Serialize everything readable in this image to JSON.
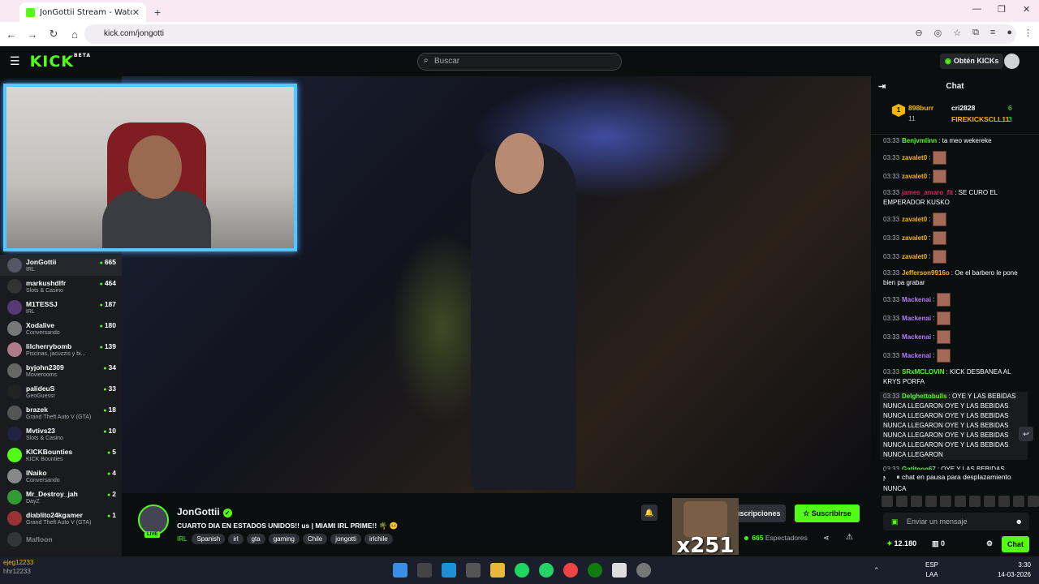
{
  "browser": {
    "tab_title": "JonGottii Stream - Watch Li",
    "url": "kick.com/jongotti"
  },
  "header": {
    "search_placeholder": "Buscar",
    "get_kicks": "Obtén KICKs"
  },
  "sidebar": {
    "items": [
      {
        "name": "JonGottii",
        "category": "IRL",
        "viewers": "665",
        "avatar_color": "#556"
      },
      {
        "name": "markushdlfr",
        "category": "Slots & Casino",
        "viewers": "464",
        "avatar_color": "#333"
      },
      {
        "name": "M1TESSJ",
        "category": "IRL",
        "viewers": "187",
        "avatar_color": "#553a77"
      },
      {
        "name": "Xodalive",
        "category": "Conversando",
        "viewers": "180",
        "avatar_color": "#777"
      },
      {
        "name": "lilcherrybomb",
        "category": "Piscinas, jacuzzis y bi...",
        "viewers": "139",
        "avatar_color": "#b07a88"
      },
      {
        "name": "byjohn2309",
        "category": "Movierooms",
        "viewers": "34",
        "avatar_color": "#666"
      },
      {
        "name": "palideuS",
        "category": "GeoGuessr",
        "viewers": "33",
        "avatar_color": "#222"
      },
      {
        "name": "brazek",
        "category": "Grand Theft Auto V (GTA)",
        "viewers": "18",
        "avatar_color": "#555"
      },
      {
        "name": "Mvtivs23",
        "category": "Slots & Casino",
        "viewers": "10",
        "avatar_color": "#224"
      },
      {
        "name": "KICKBounties",
        "category": "KICK Bounties",
        "viewers": "5",
        "avatar_color": "#53fc18"
      },
      {
        "name": "lNaiko",
        "category": "Conversando",
        "viewers": "4",
        "avatar_color": "#888"
      },
      {
        "name": "Mr_Destroy_jah",
        "category": "DayZ",
        "viewers": "2",
        "avatar_color": "#393"
      },
      {
        "name": "diablito24kgamer",
        "category": "Grand Theft Auto V (GTA)",
        "viewers": "1",
        "avatar_color": "#933"
      },
      {
        "name": "Mafloon",
        "category": "",
        "viewers": "",
        "avatar_color": "#555"
      }
    ]
  },
  "stream": {
    "channel": "JonGottii",
    "live": "LIVE",
    "title": "CUARTO DIA EN ESTADOS UNIDOS!! us | MIAMI IRL PRIME!! 🌴 🤒",
    "category": "IRL",
    "tags": [
      "Spanish",
      "irl",
      "gta",
      "gaming",
      "Chile",
      "jongotti",
      "irlchile"
    ],
    "subscriptions_label": "uscripciones",
    "subscribe_label": "Suscribirse",
    "viewers": "665",
    "viewers_label": "Espectadores",
    "overlay_multiplier": "x251"
  },
  "chat": {
    "title": "Chat",
    "pinned": {
      "user1": "898burr",
      "count1": "11",
      "user2": "cri2828",
      "count2": "6",
      "user3": "FIREKICKSCLL11",
      "count3": "3"
    },
    "messages": [
      {
        "time": "03:33",
        "user": "Benjvmlinn",
        "color": "#53fc18",
        "text": "ta meo wekereke",
        "emote": false
      },
      {
        "time": "03:33",
        "user": "zavalet0",
        "color": "#f6b600",
        "text": "",
        "emote": true
      },
      {
        "time": "03:33",
        "user": "zavalet0",
        "color": "#f6b600",
        "text": "",
        "emote": true
      },
      {
        "time": "03:33",
        "user": "james_amaro_fit",
        "color": "#e0245e",
        "text": "SE CURO EL EMPERADOR KUSKO",
        "emote": false
      },
      {
        "time": "03:33",
        "user": "zavalet0",
        "color": "#f6b600",
        "text": "",
        "emote": true
      },
      {
        "time": "03:33",
        "user": "zavalet0",
        "color": "#f6b600",
        "text": "",
        "emote": true
      },
      {
        "time": "03:33",
        "user": "zavalet0",
        "color": "#f6b600",
        "text": "",
        "emote": true
      },
      {
        "time": "03:33",
        "user": "Jefferson9916o",
        "color": "#f6b600",
        "text": "Oe el barbero le pone bien pa grabar",
        "emote": false
      },
      {
        "time": "03:33",
        "user": "Mackenai",
        "color": "#b57bff",
        "text": "",
        "emote": true
      },
      {
        "time": "03:33",
        "user": "Mackenai",
        "color": "#b57bff",
        "text": "",
        "emote": true
      },
      {
        "time": "03:33",
        "user": "Mackenai",
        "color": "#b57bff",
        "text": "",
        "emote": true
      },
      {
        "time": "03:33",
        "user": "Mackenai",
        "color": "#b57bff",
        "text": "",
        "emote": true
      },
      {
        "time": "03:33",
        "user": "SRxMCLOVIN",
        "color": "#53fc18",
        "text": "KICK DESBANEA AL KRYS PORFA",
        "emote": false
      },
      {
        "time": "03:33",
        "user": "Delghettobulls",
        "color": "#53fc18",
        "text": "OYE Y LAS BEBIDAS NUNCA LLEGARON OYE Y LAS BEBIDAS NUNCA LLEGARON OYE Y LAS BEBIDAS NUNCA LLEGARON OYE Y LAS BEBIDAS NUNCA LLEGARON OYE Y LAS BEBIDAS NUNCA LLEGARON OYE Y LAS BEBIDAS NUNCA LLEGARON",
        "emote": false,
        "highlight": true
      },
      {
        "time": "03:33",
        "user": "Gatitooo67",
        "color": "#53fc18",
        "text": "OYE Y LAS BEBIDAS NUNCA LLEGARON OYE Y LAS BEBIDAS NUNCA",
        "emote": false
      }
    ],
    "paused": "chat en pausa para desplazamiento",
    "input_placeholder": "Enviar un mensaje",
    "points": "12.180",
    "zero": "0",
    "chat_button": "Chat"
  },
  "taskbar": {
    "bottom_chat_user1": "ejeg12233",
    "bottom_chat_user2": "hhr12233",
    "lang1": "ESP",
    "lang2": "LAA",
    "time": "3:30",
    "date": "14-03-2026"
  }
}
